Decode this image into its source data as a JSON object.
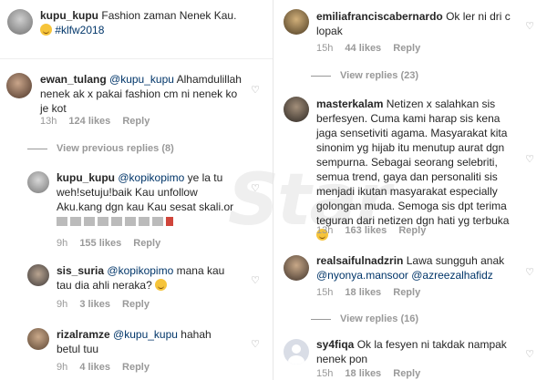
{
  "watermark": "Star",
  "left": {
    "post": {
      "user": "kupu_kupu",
      "text": "Fashion zaman Nenek Kau.",
      "hashtag": "#klfw2018"
    },
    "c1": {
      "user": "ewan_tulang",
      "mention": "@kupu_kupu",
      "text_a": "Alhamdulillah",
      "text_b": "nenek ak x pakai fashion cm ni nenek ko",
      "text_c": "je kot",
      "time": "13h",
      "likes": "124 likes",
      "reply": "Reply"
    },
    "view_prev": "View previous replies (8)",
    "c2": {
      "user": "kupu_kupu",
      "mention": "@kopikopimo",
      "text_a": "ye la tu",
      "text_b": "weh!setuju!baik Kau unfollow",
      "text_c": "Aku.kang dgn kau Kau sesat skali.or",
      "time": "9h",
      "likes": "155 likes",
      "reply": "Reply"
    },
    "c3": {
      "user": "sis_suria",
      "mention": "@kopikopimo",
      "text_a": "mana kau",
      "text_b": "tau dia ahli neraka?",
      "time": "9h",
      "likes": "3 likes",
      "reply": "Reply"
    },
    "c4": {
      "user": "rizalramze",
      "mention": "@kupu_kupu",
      "text_a": "hahah",
      "text_b": "betul tuu",
      "time": "9h",
      "likes": "4 likes",
      "reply": "Reply"
    }
  },
  "right": {
    "c1": {
      "user": "emiliafranciscabernardo",
      "text_a": "Ok ler ni dri c",
      "text_b": "lopak",
      "time": "15h",
      "likes": "44 likes",
      "reply": "Reply"
    },
    "view_replies": "View replies (23)",
    "c2": {
      "user": "masterkalam",
      "lines": [
        "Netizen x salahkan sis",
        "berfesyen. Cuma kami harap sis kena",
        "jaga sensetiviti agama. Masyarakat kita",
        "sinonim yg hijab itu menutup aurat dgn",
        "sempurna. Sebagai seorang selebriti,",
        "semua trend, gaya dan personaliti sis",
        "menjadi ikutan masyarakat especially",
        "golongan muda. Semoga sis dpt terima",
        "teguran dari netizen dgn hati yg terbuka"
      ],
      "time": "13h",
      "likes": "163 likes",
      "reply": "Reply"
    },
    "c3": {
      "user": "realsaifulnadzrin",
      "text_a": "Lawa sungguh anak",
      "mention1": "@nyonya.mansoor",
      "mention2": "@azreezalhafidz",
      "time": "15h",
      "likes": "18 likes",
      "reply": "Reply"
    },
    "view_replies2": "View replies (16)",
    "c4": {
      "user": "sy4fiqa",
      "text_a": "Ok la fesyen ni takdak nampak",
      "text_b": "nenek pon",
      "time": "15h",
      "likes": "18 likes",
      "reply": "Reply"
    }
  },
  "icons": {
    "like": "heart-icon",
    "emoji": "smile-emoji"
  }
}
